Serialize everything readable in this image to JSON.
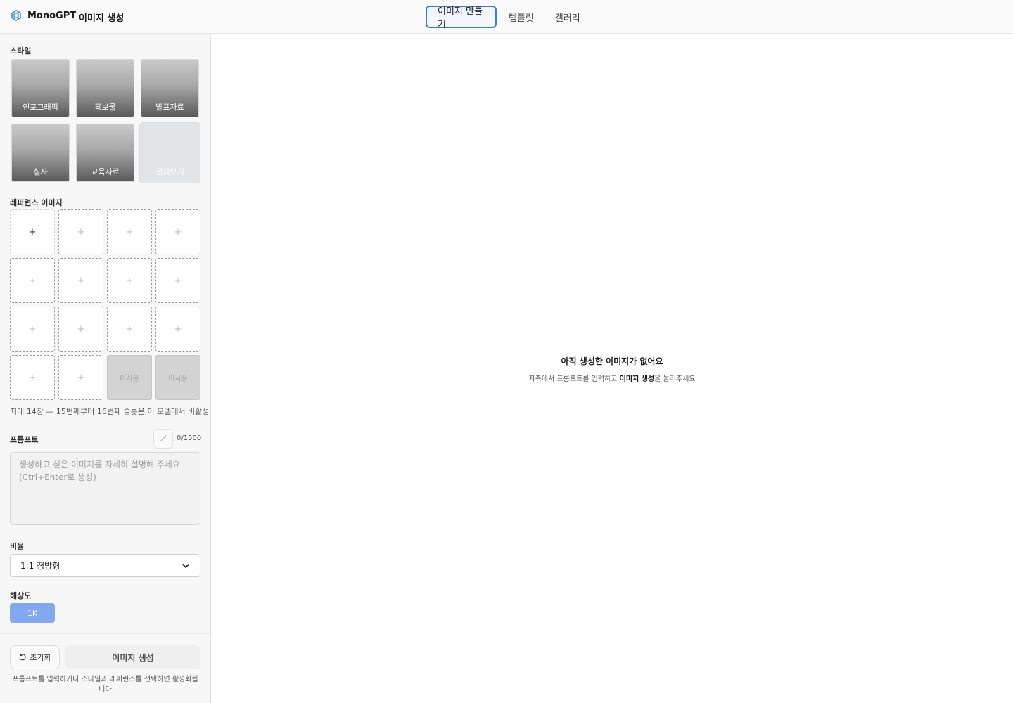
{
  "header": {
    "brand": "MonoGPT",
    "page_title": "이미지 생성",
    "tabs": [
      {
        "label": "이미지 만들기",
        "active": true
      },
      {
        "label": "템플릿",
        "active": false
      },
      {
        "label": "갤러리",
        "active": false
      }
    ]
  },
  "sidebar": {
    "style_label": "스타일",
    "styles": [
      "인포그래픽",
      "홍보물",
      "발표자료",
      "실사",
      "교육자료",
      "전체보기"
    ],
    "reference_label": "레퍼런스 이미지",
    "reference_slot_icon": "+",
    "reference_disabled_label": "미사용",
    "reference_note": "최대 14장 — 15번째부터 16번째 슬롯은 이 모델에서 비활성",
    "prompt_label": "프롬프트",
    "prompt_count": "0/1500",
    "prompt_placeholder": "생성하고 싶은 이미지를 자세히 설명해 주세요\n(Ctrl+Enter로 생성)",
    "ratio_label": "비율",
    "ratio_value": "1:1 정방형",
    "resolution_label": "해상도",
    "resolution_value": "1K",
    "reset_label": "초기화",
    "generate_label": "이미지 생성",
    "footer_note": "프롬프트를 입력하거나 스타일과 레퍼런스를 선택하면 활성화됩니다"
  },
  "main": {
    "empty_title": "아직 생성한 이미지가 없어요",
    "empty_desc_prefix": "좌측에서 프롬프트를 입력하고 ",
    "empty_desc_bold": "이미지 생성",
    "empty_desc_suffix": "을 눌러주세요"
  },
  "colors": {
    "accent": "#3b7be8",
    "resolution_active": "#82a8ef"
  },
  "icons": [
    "monogpt-logo-icon",
    "magic-wand-icon",
    "chevron-down-icon",
    "reset-icon"
  ]
}
